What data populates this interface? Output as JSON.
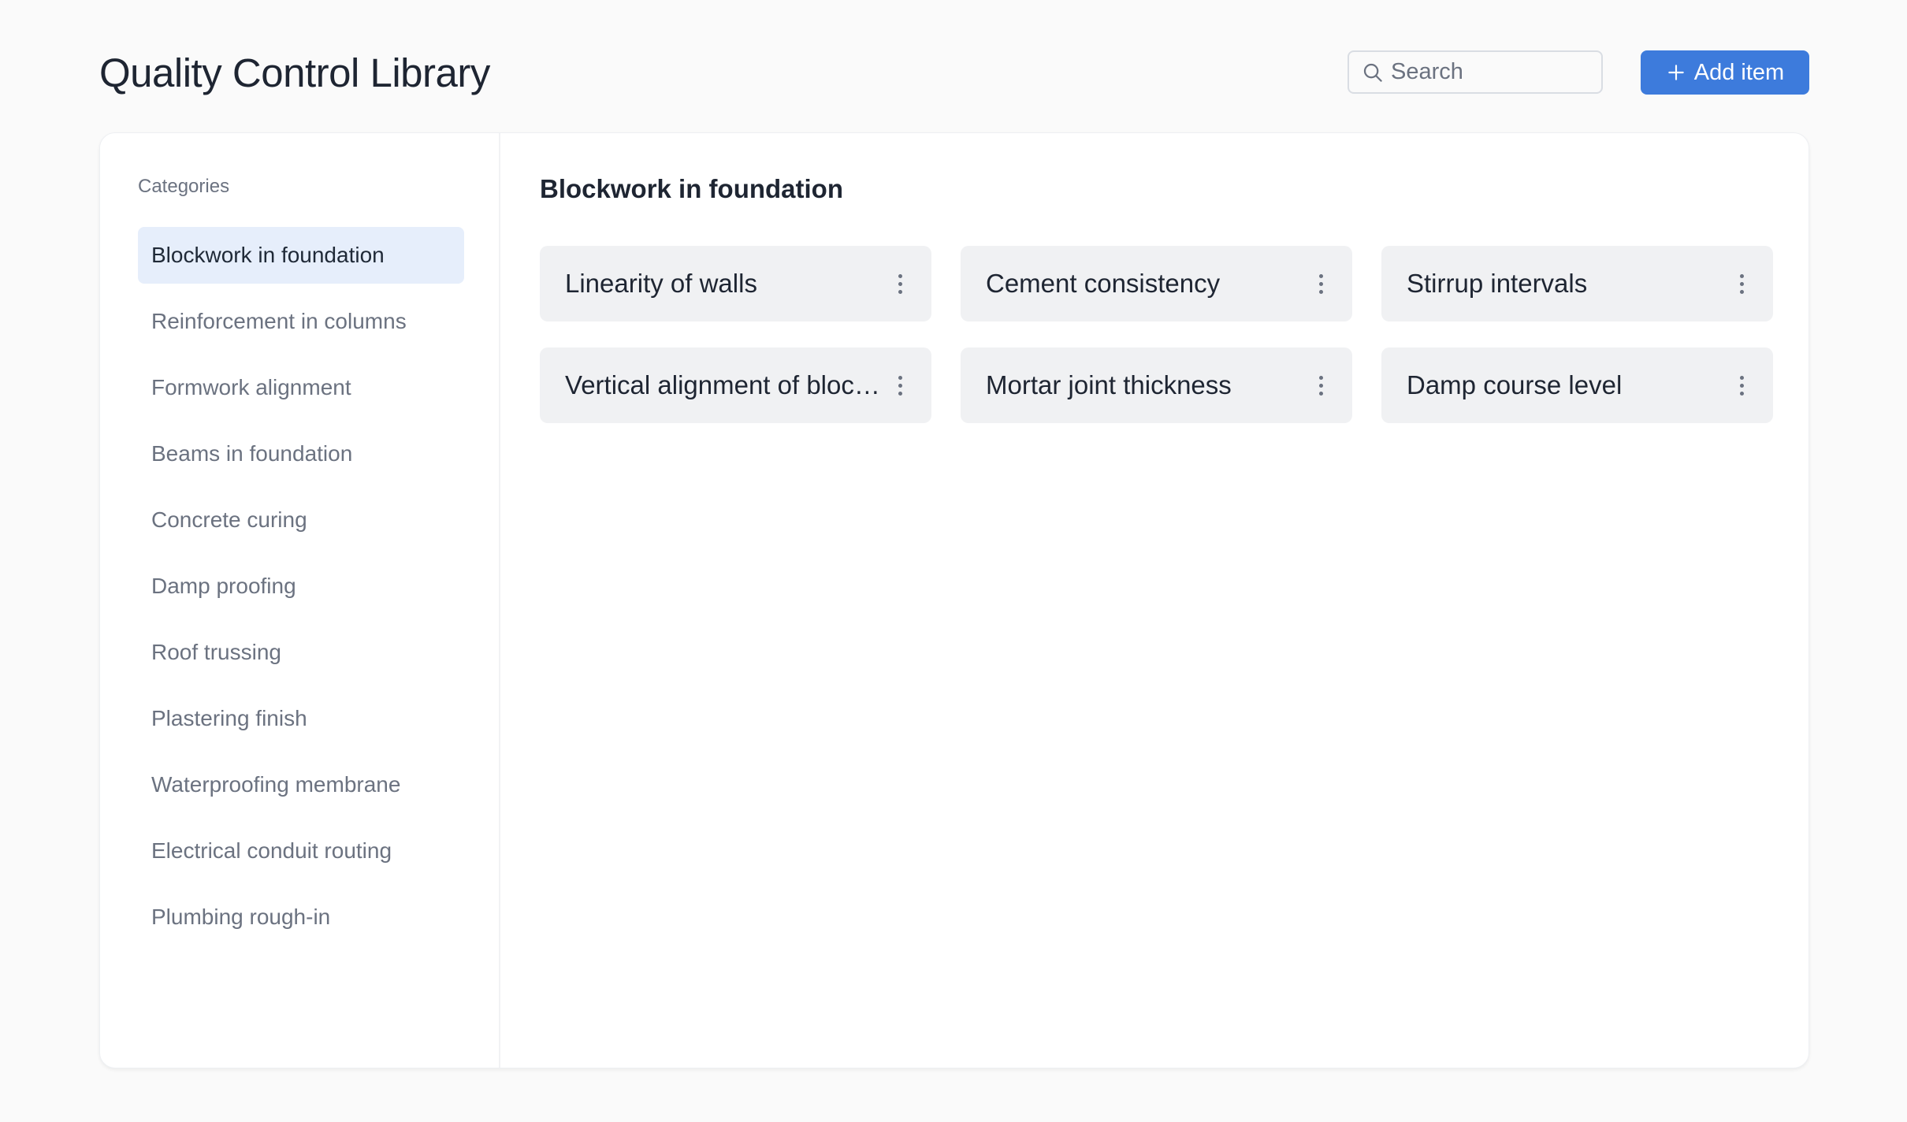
{
  "header": {
    "title": "Quality Control Library",
    "search_placeholder": "Search",
    "add_button_label": "Add item",
    "accent_color": "#3d7bdc"
  },
  "sidebar": {
    "heading": "Categories",
    "selected": "Blockwork in foundation",
    "items": [
      {
        "label": "Blockwork in foundation"
      },
      {
        "label": "Reinforcement in columns"
      },
      {
        "label": "Formwork alignment"
      },
      {
        "label": "Beams in foundation"
      },
      {
        "label": "Concrete curing"
      },
      {
        "label": "Damp proofing"
      },
      {
        "label": "Roof trussing"
      },
      {
        "label": "Plastering finish"
      },
      {
        "label": "Waterproofing membrane"
      },
      {
        "label": "Electrical conduit routing"
      },
      {
        "label": "Plumbing rough-in"
      }
    ]
  },
  "main": {
    "section_title": "Blockwork in foundation",
    "tiles": [
      {
        "label": "Linearity of walls",
        "menu_icon": "more-vertical-icon"
      },
      {
        "label": "Cement consistency",
        "menu_icon": "more-vertical-icon"
      },
      {
        "label": "Stirrup intervals",
        "menu_icon": "more-vertical-icon"
      },
      {
        "label": "Vertical alignment of block...",
        "menu_icon": "more-vertical-icon"
      },
      {
        "label": "Mortar joint thickness",
        "menu_icon": "more-vertical-icon"
      },
      {
        "label": "Damp course level",
        "menu_icon": "more-vertical-icon"
      }
    ]
  }
}
